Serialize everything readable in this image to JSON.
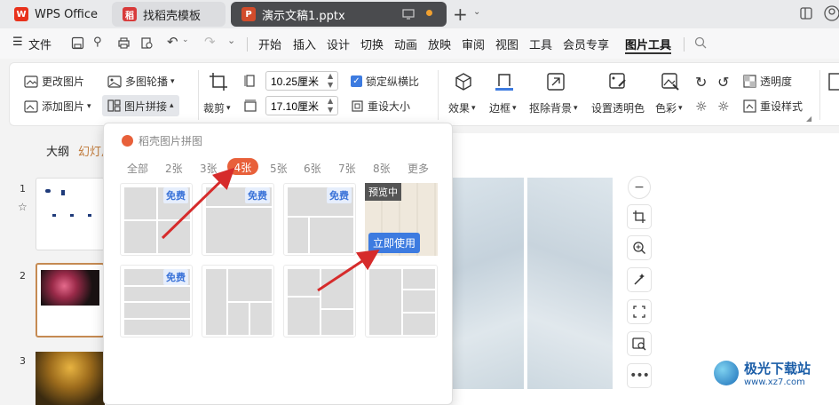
{
  "tabs": {
    "wps": {
      "label": "WPS Office"
    },
    "daoke": {
      "label": "找稻壳模板"
    },
    "doc": {
      "label": "演示文稿1.pptx"
    }
  },
  "menu": {
    "file": "文件",
    "items": [
      "开始",
      "插入",
      "设计",
      "切换",
      "动画",
      "放映",
      "审阅",
      "视图",
      "工具",
      "会员专享",
      "图片工具"
    ]
  },
  "ribbon": {
    "change_image": "更改图片",
    "multi_carousel": "多图轮播",
    "add_image": "添加图片",
    "image_splice": "图片拼接",
    "crop": "裁剪",
    "width_value": "10.25厘米",
    "height_value": "17.10厘米",
    "lock_ratio": "锁定纵横比",
    "reset_size": "重设大小",
    "effects": "效果",
    "border": "边框",
    "remove_bg": "抠除背景",
    "set_transparent": "设置透明色",
    "color": "色彩",
    "transparency": "透明度",
    "reset_style": "重设样式"
  },
  "left_pane": {
    "outline_tab": "大纲",
    "slides_tab": "幻灯片",
    "slide_numbers": [
      "1",
      "2",
      "3"
    ]
  },
  "popup": {
    "title": "稻壳图片拼图",
    "filters": [
      "全部",
      "2张",
      "3张",
      "4张",
      "5张",
      "6张",
      "7张",
      "8张",
      "更多"
    ],
    "active_filter": "4张",
    "free_badge": "免费",
    "preview_tag": "预览中",
    "use_now": "立即使用"
  },
  "colors": {
    "accent_orange": "#e8603a",
    "brand_blue": "#3d7be0",
    "arrow_red": "#d62b2b"
  },
  "watermark": {
    "text": "极光下载站",
    "url": "www.xz7.com"
  }
}
